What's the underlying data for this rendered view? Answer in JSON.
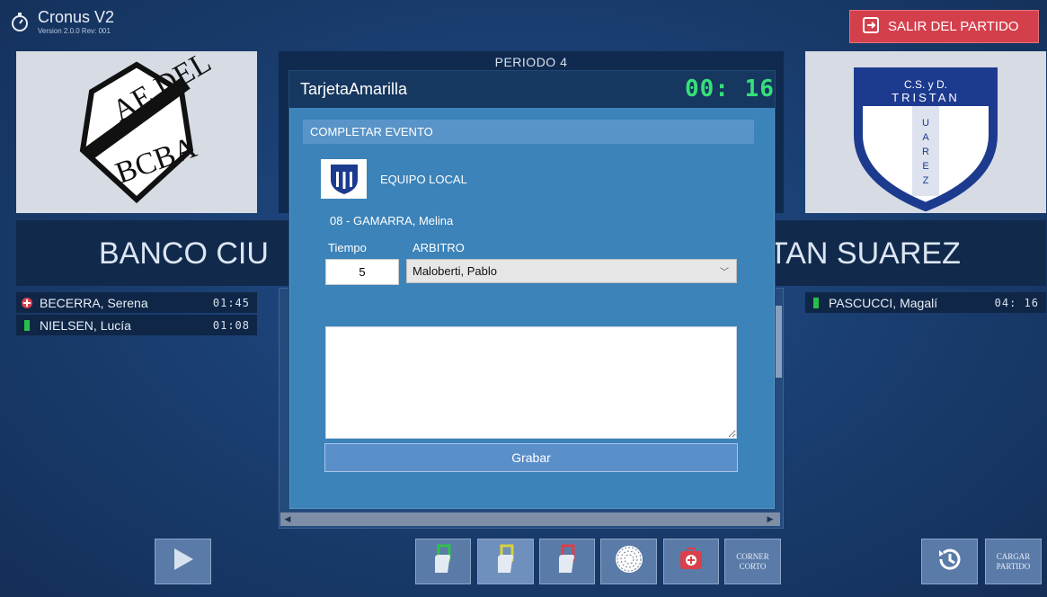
{
  "app": {
    "title": "Cronus V2",
    "version": "Version 2.0.0 Rev: 001",
    "exit_label": "SALIR DEL PARTIDO"
  },
  "match": {
    "period": "PERIODO  4",
    "home_team": "BANCO CIUDAD",
    "away_team": "TRISTAN SUAREZ",
    "home_team_visible": "BANCO CIU",
    "away_team_visible": "TAN SUAREZ"
  },
  "sanctions": {
    "home": [
      {
        "name": "BECERRA, Serena",
        "time": "01:45",
        "type": "red-plus-icon"
      },
      {
        "name": "NIELSEN, Lucía",
        "time": "01:08",
        "type": "green-card-icon"
      }
    ],
    "away": [
      {
        "name": "PASCUCCI, Magalí",
        "time": "04: 16",
        "type": "green-card-icon"
      }
    ]
  },
  "modal": {
    "title": "TarjetaAmarilla",
    "timer": "00: 16",
    "section": "COMPLETAR EVENTO",
    "team_label": "EQUIPO LOCAL",
    "player": "08 - GAMARRA, Melina",
    "tiempo_label": "Tiempo",
    "tiempo_value": "5",
    "arbitro_label": "ARBITRO",
    "arbitro_value": "Maloberti, Pablo",
    "notes_value": "",
    "save_label": "Grabar"
  },
  "toolbar": {
    "corner_line1": "CORNER",
    "corner_line2": "CORTO",
    "load_line1": "CARGAR",
    "load_line2": "PARTIDO"
  },
  "colors": {
    "background": "#1a3f72",
    "exit_button": "#d43f4c",
    "modal": "#3b83b9",
    "timer": "#35e07a"
  }
}
